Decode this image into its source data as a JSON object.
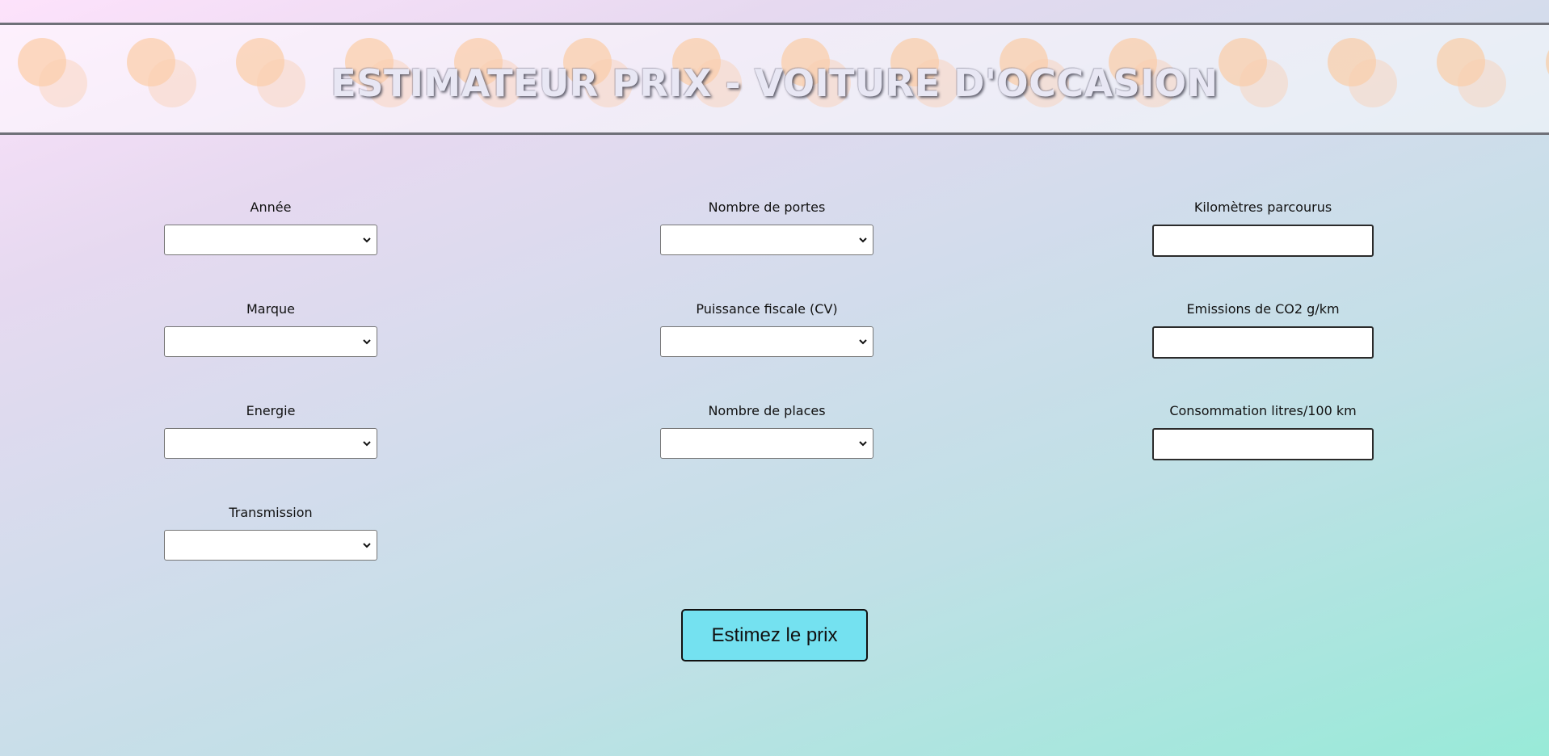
{
  "header": {
    "title": "ESTIMATEUR PRIX - VOITURE D'OCCASION"
  },
  "form": {
    "selects": {
      "annee": {
        "label": "Année",
        "value": ""
      },
      "marque": {
        "label": "Marque",
        "value": ""
      },
      "energie": {
        "label": "Energie",
        "value": ""
      },
      "transmission": {
        "label": "Transmission",
        "value": ""
      },
      "portes": {
        "label": "Nombre de portes",
        "value": ""
      },
      "puissance": {
        "label": "Puissance fiscale (CV)",
        "value": ""
      },
      "places": {
        "label": "Nombre de places",
        "value": ""
      }
    },
    "inputs": {
      "kilometres": {
        "label": "Kilomètres parcourus",
        "value": ""
      },
      "emissions": {
        "label": "Emissions de CO2 g/km",
        "value": ""
      },
      "consommation": {
        "label": "Consommation litres/100 km",
        "value": ""
      }
    },
    "submit_label": "Estimez le prix"
  },
  "icons": {
    "select_arrow": "chevron-down-icon"
  },
  "colors": {
    "submit_button": "#74e1f0",
    "header_circles": "#fcc89b"
  }
}
